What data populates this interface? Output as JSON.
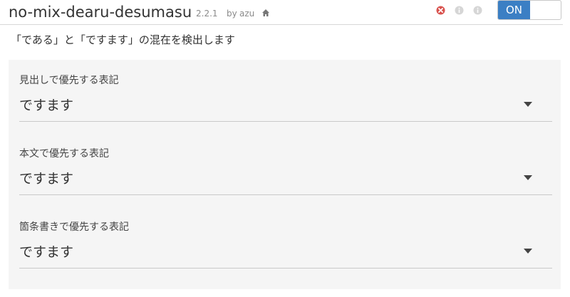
{
  "header": {
    "title": "no-mix-dearu-desumasu",
    "version": "2.2.1",
    "by_label": "by",
    "author": "azu",
    "icons": {
      "home": "home-icon",
      "remove": "remove-icon",
      "info": "info-icon",
      "help": "info-icon"
    },
    "toggle_label": "ON",
    "toggle_state": "on",
    "accent_color": "#3b7fc4",
    "remove_color": "#d9534f"
  },
  "description": "「である」と「ですます」の混在を検出します",
  "options": [
    {
      "label": "見出しで優先する表記",
      "value": "ですます"
    },
    {
      "label": "本文で優先する表記",
      "value": "ですます"
    },
    {
      "label": "箇条書きで優先する表記",
      "value": "ですます"
    }
  ]
}
